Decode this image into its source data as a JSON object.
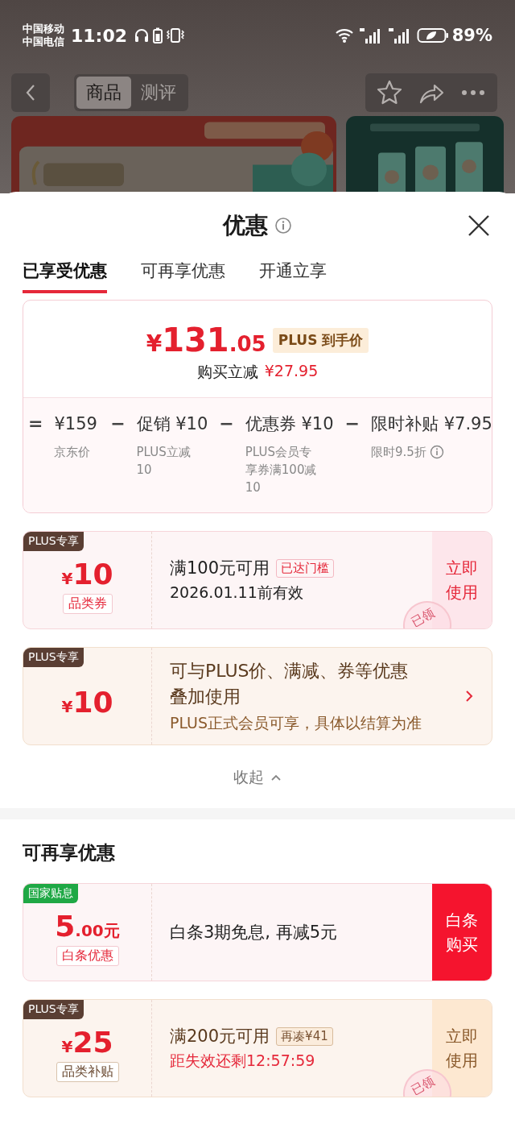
{
  "status_bar": {
    "carriers": [
      "中国移动",
      "中国电信"
    ],
    "time": "11:02",
    "battery": "89%"
  },
  "nav": {
    "tabs": [
      {
        "label": "商品",
        "selected": true
      },
      {
        "label": "测评",
        "selected": false
      }
    ]
  },
  "sheet": {
    "title": "优惠",
    "tabs": [
      {
        "label": "已享受优惠",
        "selected": true
      },
      {
        "label": "可再享优惠",
        "selected": false
      },
      {
        "label": "开通立享",
        "selected": false
      }
    ],
    "price_card": {
      "currency": "¥",
      "integer": "131",
      "decimal": ".05",
      "badge": "PLUS 到手价",
      "saving_label": "购买立减",
      "saving": "¥27.95",
      "breakdown": [
        {
          "operator": "=",
          "amount": "¥159",
          "note": "京东价",
          "info": false
        },
        {
          "operator": "−",
          "label": "促销",
          "amount": "¥10",
          "note": "PLUS立减10",
          "info": false
        },
        {
          "operator": "−",
          "label": "优惠券",
          "amount": "¥10",
          "note": "PLUS会员专享券满100减10",
          "info": false
        },
        {
          "operator": "−",
          "label": "限时补贴",
          "amount": "¥7.95",
          "note": "限时9.5折",
          "info": true
        }
      ]
    },
    "coupons": [
      {
        "kind": "voucher",
        "tag": "PLUS专享",
        "color": "#5a3e33",
        "prefix": "¥",
        "amount": "10",
        "category": "品类券",
        "title": "满100元可用",
        "chip": "已达门槛",
        "note": "2026.01.11前有效",
        "note_alert": false,
        "action": "立即使用",
        "stamp": "已领"
      },
      {
        "kind": "benefit",
        "tag": "PLUS专享",
        "color": "#5a3e33",
        "prefix": "¥",
        "amount": "10",
        "title": "可与PLUS价、满减、券等优惠叠加使用",
        "note": "PLUS正式会员可享，具体以结算为准",
        "note_alert": false
      }
    ],
    "collapse": "收起",
    "section_title": "可再享优惠",
    "more_coupons": [
      {
        "kind": "interest",
        "tag": "国家贴息",
        "color": "#1fa845",
        "amount": "5",
        "suffix": ".00元",
        "category": "白条优惠",
        "title": "白条3期免息, 再减5元",
        "action": "白条购买"
      },
      {
        "kind": "subsidy",
        "tag": "PLUS专享",
        "color": "#5a3e33",
        "prefix": "¥",
        "amount": "25",
        "category": "品类补贴",
        "title": "满200元可用",
        "chip": "再凑¥41",
        "note": "距失效还剩12:57:59",
        "note_alert": true,
        "action": "立即使用",
        "stamp": "已领"
      }
    ]
  }
}
